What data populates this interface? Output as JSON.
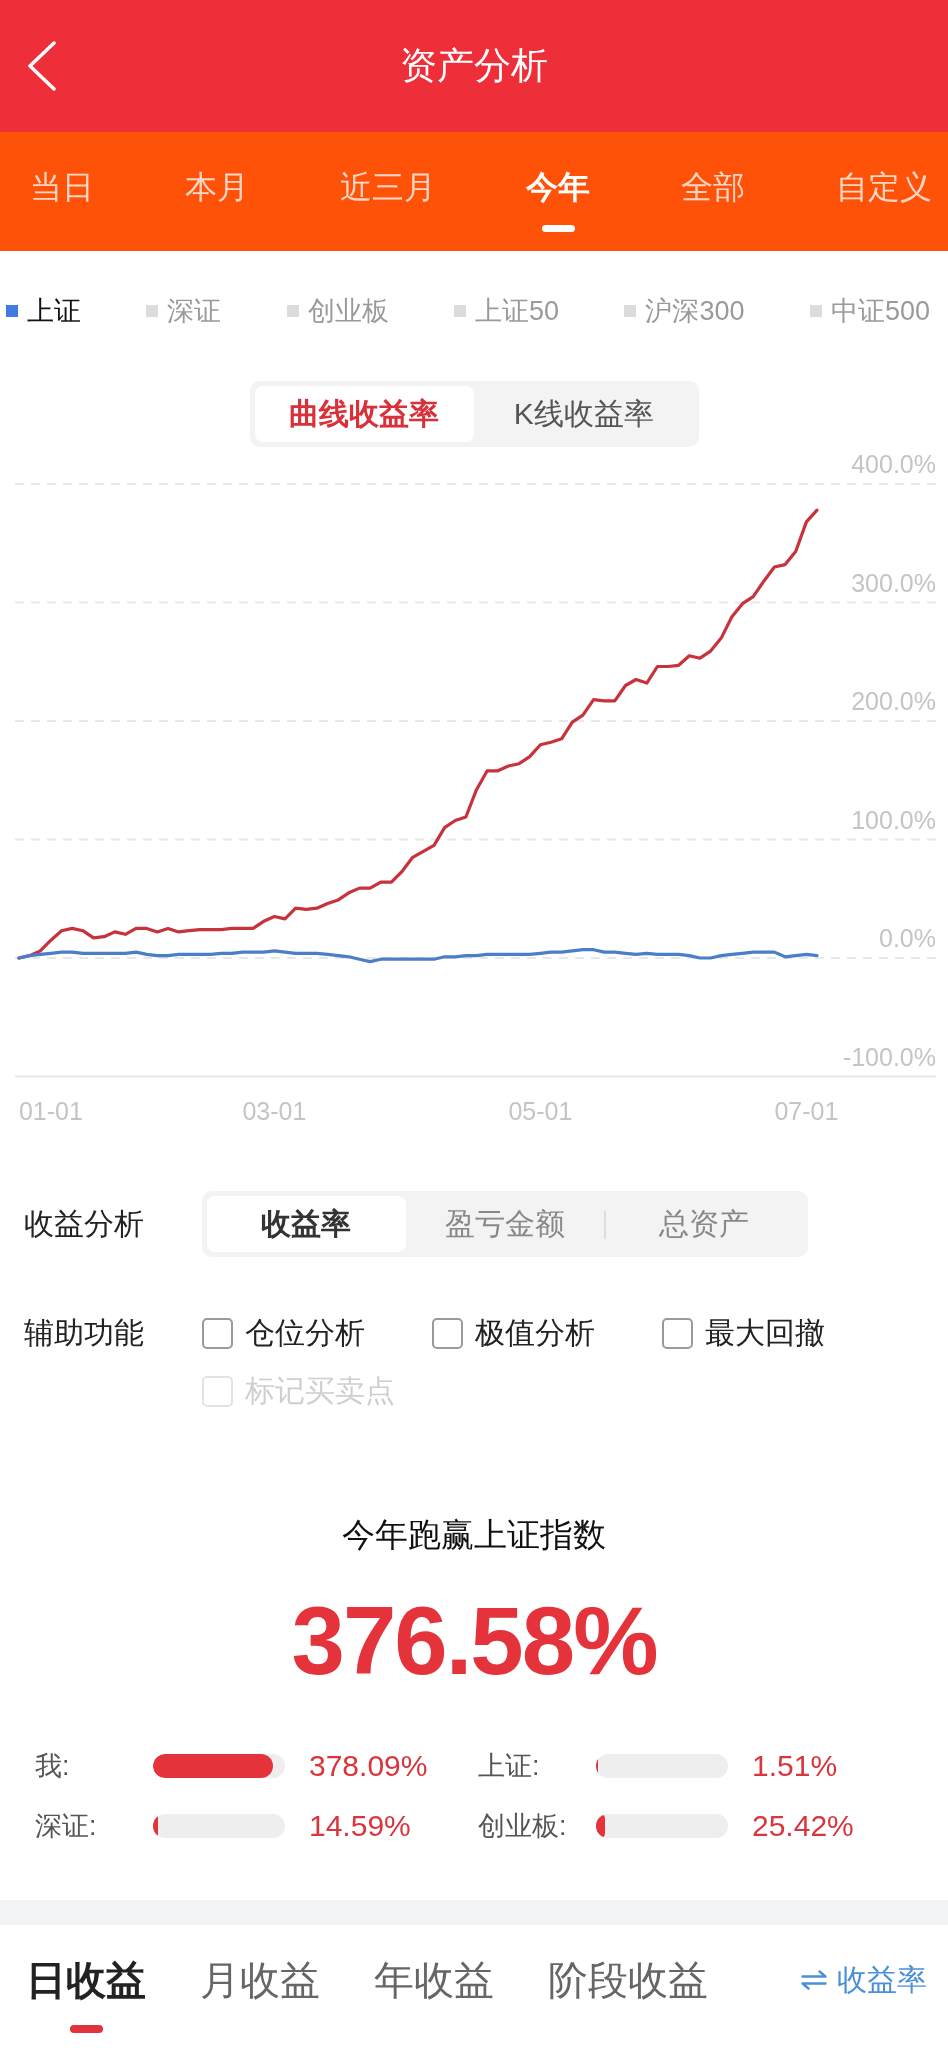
{
  "header": {
    "title": "资产分析"
  },
  "period_tabs": [
    {
      "label": "当日",
      "selected": false
    },
    {
      "label": "本月",
      "selected": false
    },
    {
      "label": "近三月",
      "selected": false
    },
    {
      "label": "今年",
      "selected": true
    },
    {
      "label": "全部",
      "selected": false
    },
    {
      "label": "自定义",
      "selected": false
    }
  ],
  "index_legend": [
    {
      "label": "上证",
      "selected": true
    },
    {
      "label": "深证",
      "selected": false
    },
    {
      "label": "创业板",
      "selected": false
    },
    {
      "label": "上证50",
      "selected": false
    },
    {
      "label": "沪深300",
      "selected": false
    },
    {
      "label": "中证500",
      "selected": false
    }
  ],
  "chart_mode": [
    {
      "label": "曲线收益率",
      "selected": true
    },
    {
      "label": "K线收益率",
      "selected": false
    }
  ],
  "chart": {
    "chart_data": {
      "type": "line",
      "grid": true,
      "categories": [
        null,
        null,
        null,
        "01-01",
        null,
        null,
        null,
        null,
        null,
        null,
        null,
        null,
        null,
        null,
        null,
        null,
        null,
        null,
        null,
        null,
        null,
        null,
        null,
        null,
        "03-01",
        null,
        null,
        null,
        null,
        null,
        null,
        null,
        null,
        null,
        null,
        null,
        null,
        null,
        null,
        null,
        null,
        null,
        null,
        null,
        null,
        null,
        null,
        null,
        null,
        "05-01",
        null,
        null,
        null,
        null,
        null,
        null,
        null,
        null,
        null,
        null,
        null,
        null,
        null,
        null,
        null,
        null,
        null,
        null,
        null,
        null,
        null,
        null,
        null,
        null,
        "07-01",
        null
      ],
      "series": [
        {
          "color": "#c8323a",
          "values": [
            0,
            2,
            6,
            15,
            23,
            25,
            23,
            17,
            18,
            22,
            20,
            25,
            25,
            22,
            25,
            22,
            23,
            24,
            24,
            24,
            25,
            25,
            25,
            31,
            35,
            33,
            42,
            41,
            42,
            46,
            49,
            55,
            59,
            59,
            64,
            64,
            73,
            85,
            90,
            95,
            110,
            116,
            119,
            142,
            158,
            158,
            162,
            164,
            170,
            180,
            182,
            185,
            199,
            205,
            218,
            217,
            217,
            230,
            235,
            232,
            246,
            246,
            247,
            255,
            253,
            259,
            270,
            288,
            299,
            305,
            318,
            330,
            332,
            343,
            368,
            378
          ]
        },
        {
          "color": "#4a7ec6",
          "values": [
            0,
            2,
            3,
            4,
            5,
            5,
            4,
            4,
            4,
            4,
            4,
            5,
            3,
            2,
            2,
            3,
            3,
            3,
            3,
            4,
            4,
            5,
            5,
            5,
            6,
            5,
            4,
            4,
            4,
            3,
            2,
            1,
            -1,
            -3,
            -1,
            -1,
            -1,
            -1,
            -1,
            -1,
            1,
            1,
            2,
            2,
            3,
            3,
            3,
            3,
            3,
            4,
            5,
            5,
            6,
            7,
            7,
            5,
            5,
            4,
            3,
            4,
            3,
            3,
            3,
            2,
            0,
            0,
            2,
            3,
            4,
            5,
            5,
            5,
            1,
            2,
            3,
            2
          ]
        }
      ],
      "ylim": [
        -100,
        400
      ],
      "yticks": [
        {
          "value": -100,
          "label": "-100.0%"
        },
        {
          "value": 0,
          "label": "0.0%"
        },
        {
          "value": 100,
          "label": "100.0%"
        },
        {
          "value": 200,
          "label": "200.0%"
        },
        {
          "value": 300,
          "label": "300.0%"
        },
        {
          "value": 400,
          "label": "400.0%"
        }
      ]
    }
  },
  "return_analysis": {
    "label": "收益分析",
    "options": [
      {
        "label": "收益率",
        "selected": true
      },
      {
        "label": "盈亏金额",
        "selected": false
      },
      {
        "label": "总资产",
        "selected": false
      }
    ]
  },
  "auxiliary": {
    "label": "辅助功能",
    "options": [
      {
        "label": "仓位分析",
        "checked": false,
        "disabled": false
      },
      {
        "label": "极值分析",
        "checked": false,
        "disabled": false
      },
      {
        "label": "最大回撤",
        "checked": false,
        "disabled": false
      },
      {
        "label": "标记买卖点",
        "checked": false,
        "disabled": true
      }
    ]
  },
  "summary": {
    "title": "今年跑赢上证指数",
    "value": "376.58%",
    "comparisons": [
      {
        "label": "我:",
        "level": 0.91,
        "value": "378.09%"
      },
      {
        "label": "上证:",
        "level": 0.015,
        "value": "1.51%"
      },
      {
        "label": "深证:",
        "level": 0.04,
        "value": "14.59%"
      },
      {
        "label": "创业板:",
        "level": 0.07,
        "value": "25.42%"
      }
    ]
  },
  "bottom_tabs": [
    {
      "label": "日收益",
      "selected": true
    },
    {
      "label": "月收益",
      "selected": false
    },
    {
      "label": "年收益",
      "selected": false
    },
    {
      "label": "阶段收益",
      "selected": false
    }
  ],
  "metric_toggle": {
    "label": "收益率"
  }
}
